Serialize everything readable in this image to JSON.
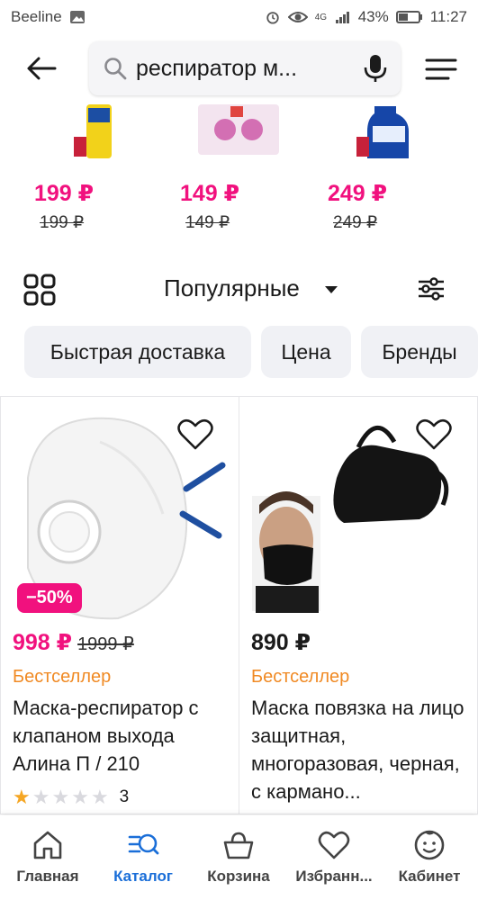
{
  "status_bar": {
    "carrier": "Beeline",
    "battery": "43%",
    "time": "11:27",
    "network": "4G"
  },
  "header": {
    "search_value": "респиратор м..."
  },
  "strip": [
    {
      "price": "199 ₽",
      "old_price": "199 ₽"
    },
    {
      "price": "149 ₽",
      "old_price": "149 ₽"
    },
    {
      "price": "249 ₽",
      "old_price": "249 ₽"
    }
  ],
  "sort": {
    "label": "Популярные"
  },
  "chips": [
    {
      "label": "Быстрая доставка"
    },
    {
      "label": "Цена"
    },
    {
      "label": "Бренды"
    }
  ],
  "products": [
    {
      "discount": "−50%",
      "price": "998 ₽",
      "old_price": "1999 ₽",
      "badge": "Бестселлер",
      "title": "Маска-респиратор с клапаном выхода Алина П / 210",
      "rating_count": "3",
      "rating_value": 1
    },
    {
      "price": "890 ₽",
      "badge": "Бестселлер",
      "title": "Маска повязка на лицо защитная, многоразовая, черная, с кармано..."
    }
  ],
  "bottom_nav": [
    {
      "label": "Главная",
      "icon": "home-icon"
    },
    {
      "label": "Каталог",
      "icon": "catalog-search-icon",
      "active": true
    },
    {
      "label": "Корзина",
      "icon": "basket-icon"
    },
    {
      "label": "Избранн...",
      "icon": "heart-icon"
    },
    {
      "label": "Кабинет",
      "icon": "profile-icon"
    }
  ],
  "colors": {
    "accent_pink": "#f1117e",
    "active_blue": "#1a6ed8",
    "bestseller_orange": "#f08a24"
  }
}
